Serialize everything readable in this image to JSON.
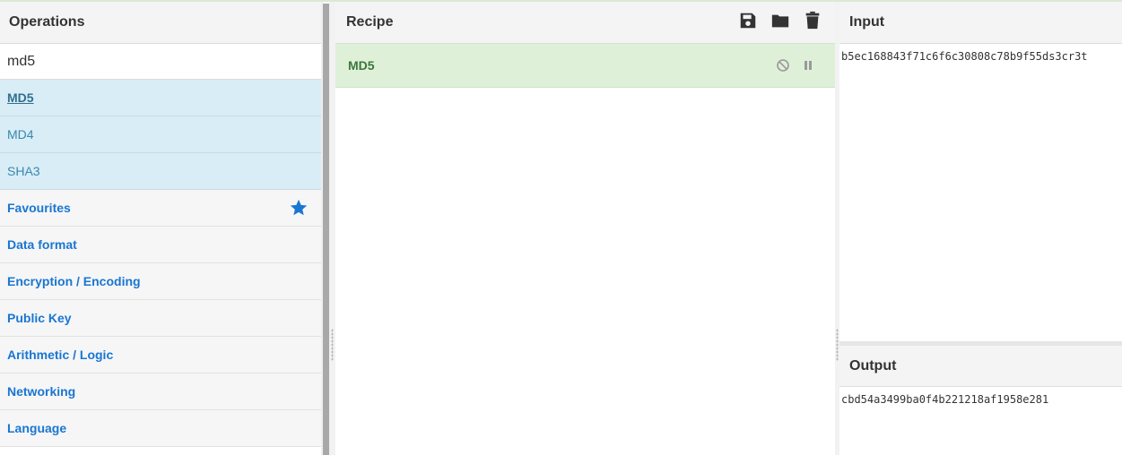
{
  "operations": {
    "title": "Operations",
    "search_value": "md5",
    "results": [
      "MD5",
      "MD4",
      "SHA3"
    ],
    "categories": [
      "Favourites",
      "Data format",
      "Encryption / Encoding",
      "Public Key",
      "Arithmetic / Logic",
      "Networking",
      "Language"
    ]
  },
  "recipe": {
    "title": "Recipe",
    "icons": [
      "save-icon",
      "folder-icon",
      "trash-icon"
    ],
    "items": [
      {
        "name": "MD5",
        "icons": [
          "disable-icon",
          "pause-icon"
        ]
      }
    ]
  },
  "input": {
    "title": "Input",
    "value": "b5ec168843f71c6f6c30808c78b9f55ds3cr3t"
  },
  "output": {
    "title": "Output",
    "value": "cbd54a3499ba0f4b221218af1958e281"
  },
  "colors": {
    "accent": "#1976d2",
    "result_bg": "#d9edf7",
    "recipe_item_bg": "#dff0d8",
    "recipe_item_text": "#3c763d"
  }
}
